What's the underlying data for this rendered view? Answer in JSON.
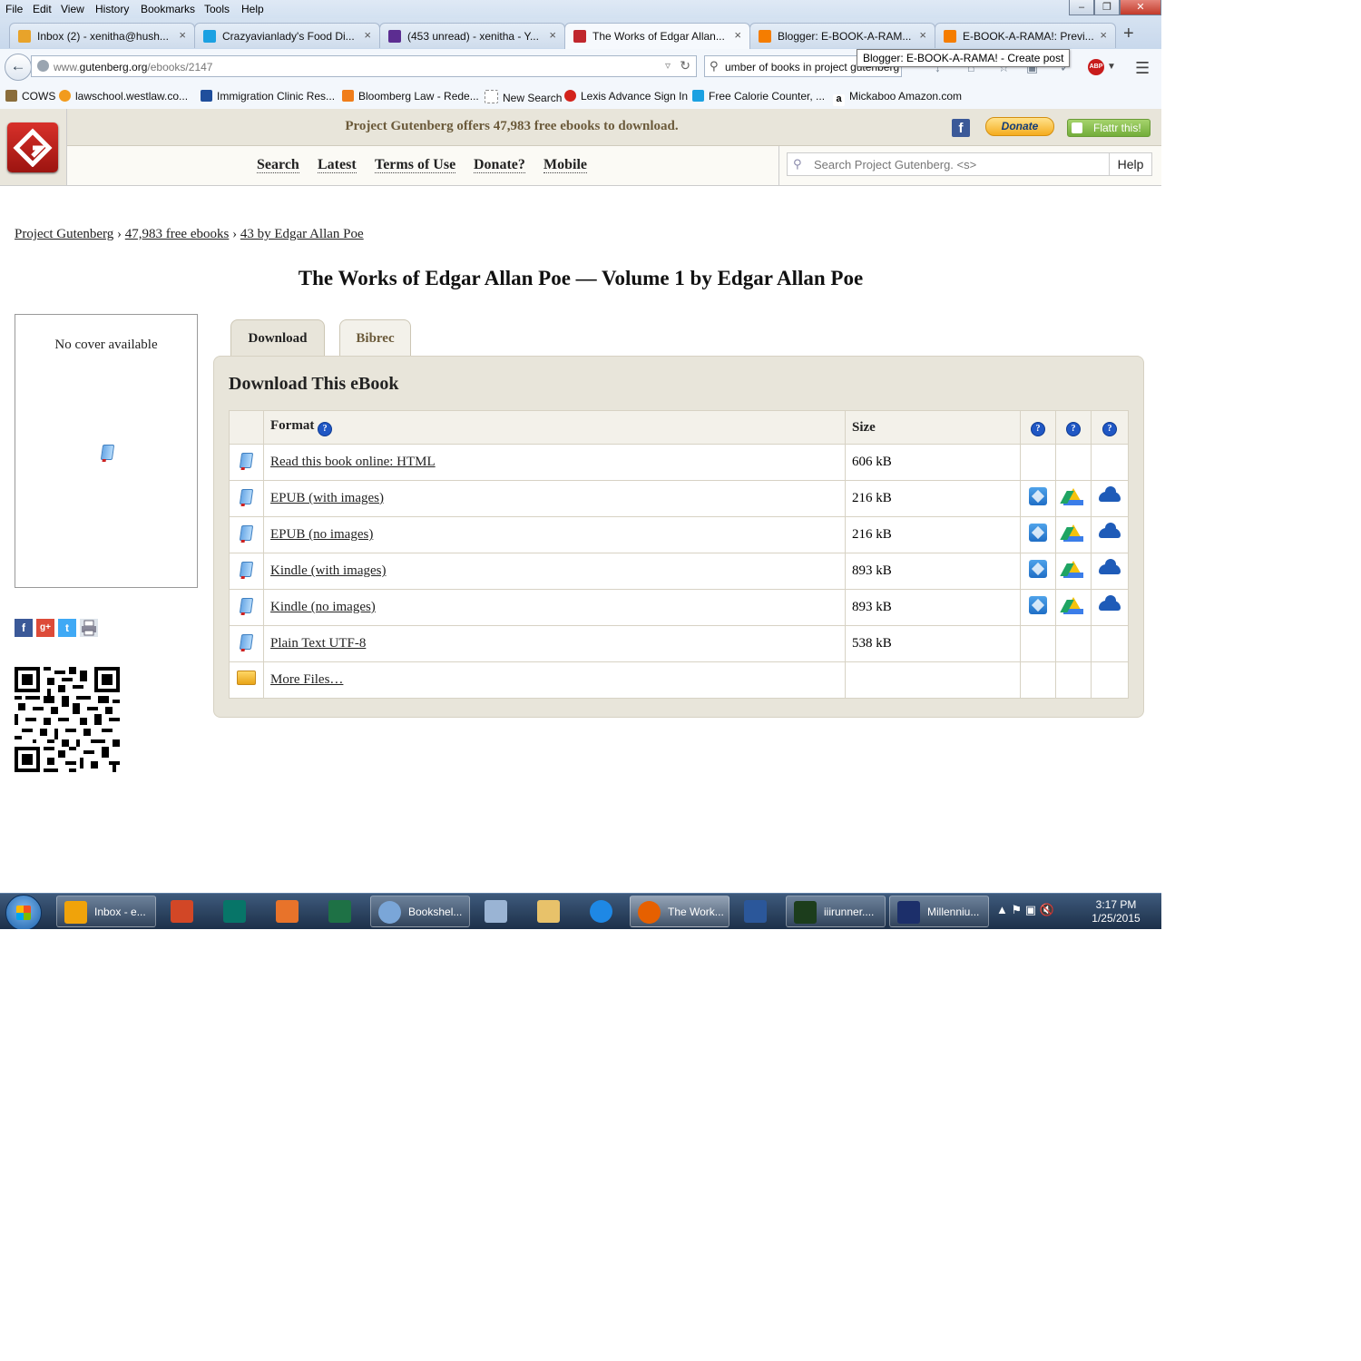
{
  "browser": {
    "menu": [
      "File",
      "Edit",
      "View",
      "History",
      "Bookmarks",
      "Tools",
      "Help"
    ],
    "window_controls": [
      "–",
      "❐",
      "✕"
    ],
    "tabs": [
      {
        "title": "Inbox (2) - xenitha@hush...",
        "color": "#e8a32a"
      },
      {
        "title": "Crazyavianlady's Food Di...",
        "color": "#1ba1e2"
      },
      {
        "title": "(453 unread) - xenitha - Y...",
        "color": "#5c2d91"
      },
      {
        "title": "The Works of Edgar Allan...",
        "color": "#c0272d"
      },
      {
        "title": "Blogger: E-BOOK-A-RAM...",
        "color": "#f57d00"
      },
      {
        "title": "E-BOOK-A-RAMA!: Previ...",
        "color": "#f57d00"
      }
    ],
    "tab_close": "×",
    "new_tab": "+",
    "url_prefix": "www.",
    "url_domain": "gutenberg.org",
    "url_path": "/ebooks/2147",
    "search_value": "umber of books in project gutenberg",
    "tooltip": "Blogger: E-BOOK-A-RAMA! - Create post",
    "abp_label": "ABP",
    "bookmarks": [
      {
        "label": "COWS",
        "color": "#8a6d3b"
      },
      {
        "label": "lawschool.westlaw.co...",
        "color": "#f29b1d"
      },
      {
        "label": "Immigration Clinic Res...",
        "color": "#1f4e9c"
      },
      {
        "label": "Bloomberg Law - Rede...",
        "color": "#f07d1a"
      },
      {
        "label": "New Search",
        "color": "#cccccc"
      },
      {
        "label": "Lexis Advance Sign In",
        "color": "#d3231c"
      },
      {
        "label": "Free Calorie Counter, ...",
        "color": "#1ba1e2"
      },
      {
        "label": "Mickaboo Amazon.com",
        "color": "#222222"
      }
    ]
  },
  "header": {
    "offer": "Project Gutenberg offers 47,983 free ebooks to download.",
    "facebook": "f",
    "donate": "Donate",
    "flattr": "Flattr this!",
    "nav": [
      "Search",
      "Latest",
      "Terms of Use",
      "Donate?",
      "Mobile"
    ],
    "search_placeholder": "Search Project Gutenberg. <s>",
    "help": "Help"
  },
  "breadcrumb": {
    "items": [
      "Project Gutenberg",
      "47,983 free ebooks",
      "43 by Edgar Allan Poe"
    ],
    "sep": "›"
  },
  "page_title": "The Works of Edgar Allan Poe — Volume 1 by Edgar Allan Poe",
  "cover": {
    "text": "No cover available"
  },
  "share": [
    "f",
    "g+",
    "t",
    "print"
  ],
  "tabs": {
    "download": "Download",
    "bibrec": "Bibrec"
  },
  "download": {
    "heading": "Download This eBook",
    "col_format": "Format",
    "col_size": "Size",
    "q": "?",
    "rows": [
      {
        "label": "Read this book online: HTML",
        "size": "606 kB",
        "services": false
      },
      {
        "label": "EPUB (with images)",
        "size": "216 kB",
        "services": true
      },
      {
        "label": "EPUB (no images)",
        "size": "216 kB",
        "services": true
      },
      {
        "label": "Kindle (with images)",
        "size": "893 kB",
        "services": true
      },
      {
        "label": "Kindle (no images)",
        "size": "893 kB",
        "services": true
      },
      {
        "label": "Plain Text UTF-8",
        "size": "538 kB",
        "services": false
      },
      {
        "label": "More Files…",
        "size": "",
        "services": false,
        "folder": true
      }
    ]
  },
  "taskbar": {
    "items": [
      {
        "label": "Inbox - e...",
        "color": "#f0a30a",
        "labeled": true
      },
      {
        "label": "",
        "color": "#d24726",
        "labeled": false
      },
      {
        "label": "",
        "color": "#077568",
        "labeled": false
      },
      {
        "label": "",
        "color": "#e8732a",
        "labeled": false
      },
      {
        "label": "",
        "color": "#1e7145",
        "labeled": false
      },
      {
        "label": "Bookshel...",
        "color": "#7aa6d8",
        "labeled": true
      },
      {
        "label": "",
        "color": "#9ab4d4",
        "labeled": false
      },
      {
        "label": "",
        "color": "#e8c26a",
        "labeled": false
      },
      {
        "label": "",
        "color": "#1e88e5",
        "labeled": false
      },
      {
        "label": "The Work...",
        "color": "#e66000",
        "labeled": true
      },
      {
        "label": "",
        "color": "#2b579a",
        "labeled": false
      },
      {
        "label": "iiirunner....",
        "color": "#1c3d1c",
        "labeled": true
      },
      {
        "label": "Millenniu...",
        "color": "#1c2f6a",
        "labeled": true
      }
    ],
    "tray": "▲  ⚑  ▣  🔇",
    "time": "3:17 PM",
    "date": "1/25/2015"
  }
}
